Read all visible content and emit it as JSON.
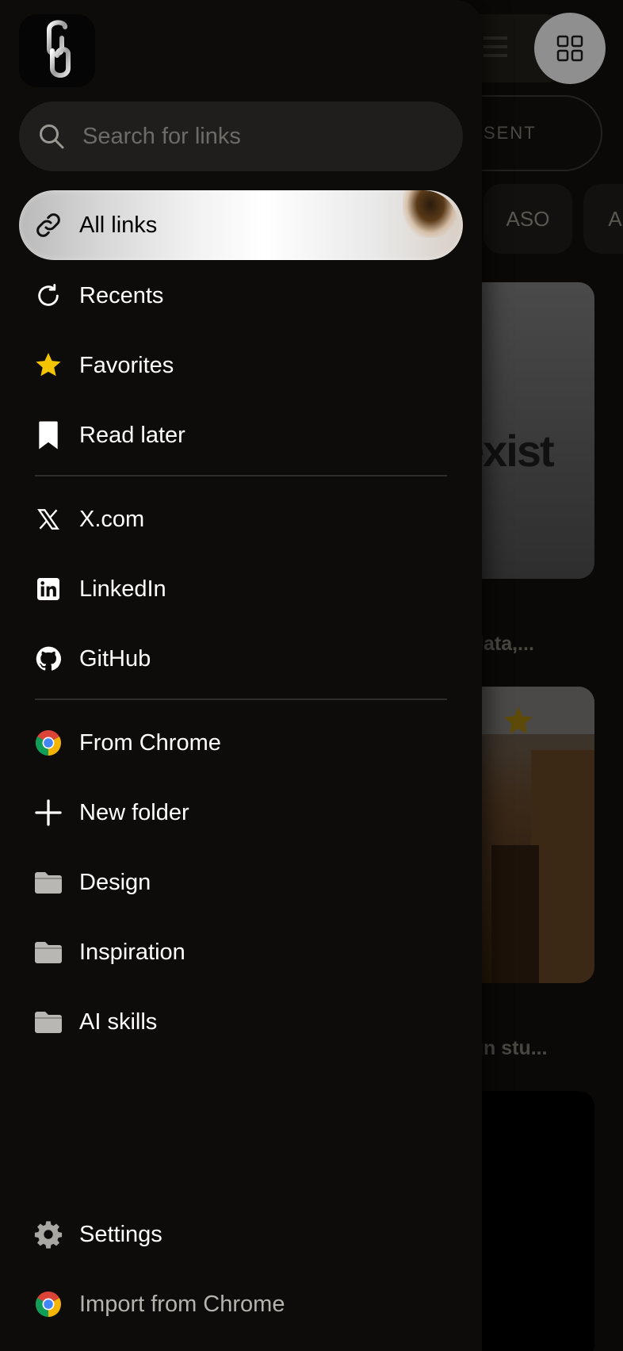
{
  "background": {
    "tab_label": "SENT",
    "chips": [
      "ASO",
      "A"
    ],
    "card1_headline": "exist",
    "card1_colon": ":",
    "caption1": "ss data,...",
    "caption2": "esign stu..."
  },
  "drawer": {
    "search": {
      "placeholder": "Search for links",
      "value": ""
    },
    "primary_items": [
      {
        "label": "All links",
        "icon": "link-icon",
        "active": true
      },
      {
        "label": "Recents",
        "icon": "recents-icon"
      },
      {
        "label": "Favorites",
        "icon": "star-icon"
      },
      {
        "label": "Read later",
        "icon": "bookmark-icon"
      }
    ],
    "source_items": [
      {
        "label": "X.com",
        "icon": "x-logo-icon"
      },
      {
        "label": "LinkedIn",
        "icon": "linkedin-icon"
      },
      {
        "label": "GitHub",
        "icon": "github-icon"
      }
    ],
    "folder_items": [
      {
        "label": "From Chrome",
        "icon": "chrome-icon"
      },
      {
        "label": "New folder",
        "icon": "plus-icon"
      },
      {
        "label": "Design",
        "icon": "folder-icon"
      },
      {
        "label": "Inspiration",
        "icon": "folder-icon"
      },
      {
        "label": "AI skills",
        "icon": "folder-icon"
      }
    ],
    "footer_items": [
      {
        "label": "Settings",
        "icon": "gear-icon"
      },
      {
        "label": "Import from Chrome",
        "icon": "chrome-icon"
      }
    ]
  },
  "colors": {
    "drawer_bg": "#0d0c0a",
    "star_yellow": "#f5c400",
    "chrome_red": "#db4437",
    "chrome_green": "#0f9d58",
    "chrome_yellow": "#f4b400",
    "chrome_blue": "#4285f4"
  }
}
